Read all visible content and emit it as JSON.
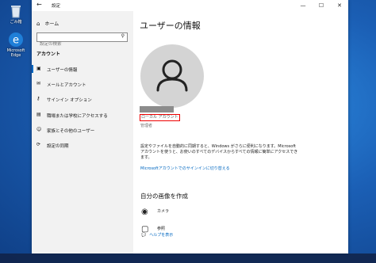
{
  "desktop": {
    "icons": [
      {
        "label": "ごみ箱"
      },
      {
        "label": "Microsoft Edge"
      }
    ]
  },
  "window": {
    "title": "設定",
    "controls": {
      "minimize": "—",
      "maximize": "☐",
      "close": "✕"
    }
  },
  "sidebar": {
    "home_label": "ホーム",
    "search_placeholder": "設定の検索",
    "section_header": "アカウント",
    "items": [
      {
        "label": "ユーザーの情報",
        "icon": "person-card-icon",
        "active": true
      },
      {
        "label": "メールとアカウント",
        "icon": "mail-icon",
        "active": false
      },
      {
        "label": "サインイン オプション",
        "icon": "key-icon",
        "active": false
      },
      {
        "label": "職場または学校にアクセスする",
        "icon": "briefcase-icon",
        "active": false
      },
      {
        "label": "家族とその他のユーザー",
        "icon": "people-icon",
        "active": false
      },
      {
        "label": "設定の同期",
        "icon": "sync-icon",
        "active": false
      }
    ]
  },
  "main": {
    "page_title": "ユーザーの情報",
    "account_type": "ローカル アカウント",
    "role": "管理者",
    "description": "設定やファイルを自動的に同期すると、Windows がさらに便利になります。Microsoft アカウントを使うと、お使いのすべてのデバイスからすべての情報に簡単にアクセスできます。",
    "ms_link": "Microsoftアカウントでのサインインに切り替える",
    "create_picture_header": "自分の画像を作成",
    "options": [
      {
        "label": "カメラ",
        "icon": "camera-icon"
      },
      {
        "label": "参照",
        "icon": "browse-icon"
      }
    ],
    "help_link": "ヘルプを表示"
  },
  "colors": {
    "accent": "#0067c0",
    "highlight_border": "#e00000",
    "sidebar_bg": "#f2f2f2"
  }
}
